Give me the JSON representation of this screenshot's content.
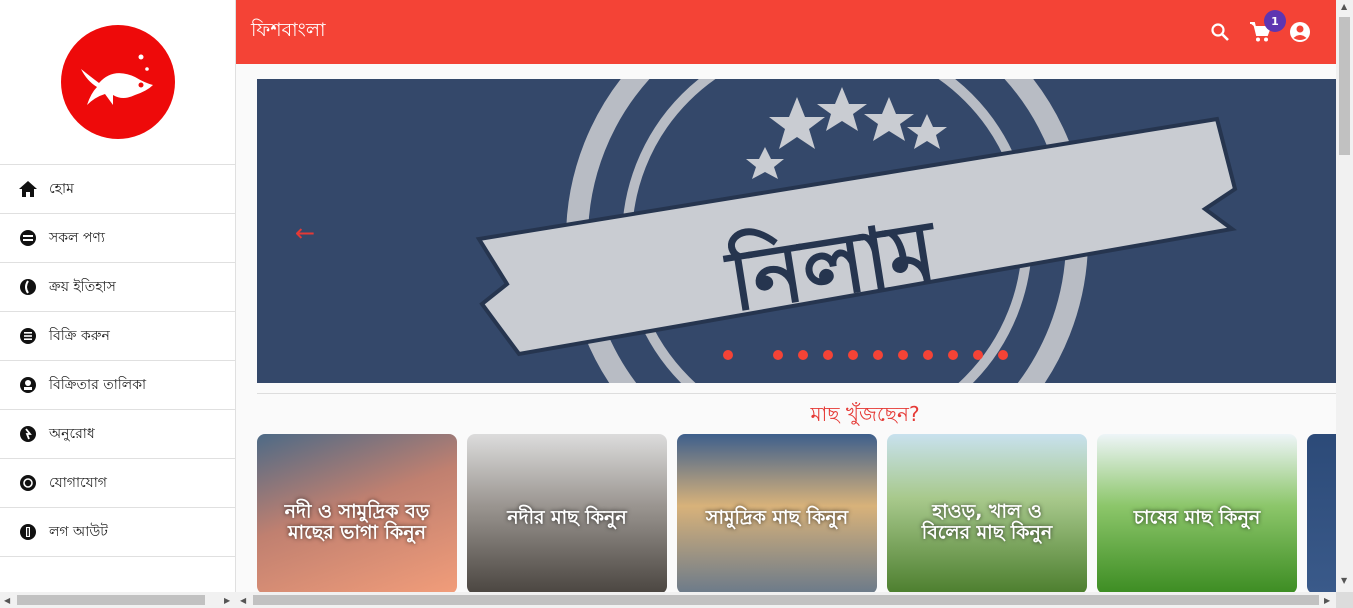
{
  "brand": {
    "title": "ফিশবাংলা",
    "primary_color": "#f44336",
    "logo_color": "#ee0a0a"
  },
  "sidebar": {
    "items": [
      {
        "label": "হোম",
        "icon": "home-icon"
      },
      {
        "label": "সকল পণ্য",
        "icon": "products-icon"
      },
      {
        "label": "ক্রয় ইতিহাস",
        "icon": "history-icon"
      },
      {
        "label": "বিক্রি করুন",
        "icon": "list-icon"
      },
      {
        "label": "বিক্রিতার তালিকা",
        "icon": "seller-icon"
      },
      {
        "label": "অনুরোধ",
        "icon": "request-icon"
      },
      {
        "label": "যোগাযোগ",
        "icon": "contact-icon"
      },
      {
        "label": "লগ আউট",
        "icon": "logout-icon"
      }
    ]
  },
  "header": {
    "cart_count": "1",
    "icons": [
      "search-icon",
      "cart-icon",
      "account-icon"
    ]
  },
  "banner": {
    "title": "নিলাম",
    "active_slide": 1,
    "slide_count": 12
  },
  "section": {
    "title": "মাছ খুঁজছেন?"
  },
  "cards": [
    {
      "label": "নদী ও সামুদ্রিক বড় মাছের ভাগা কিনুন",
      "colors": [
        "#c08070",
        "#f29d7a"
      ]
    },
    {
      "label": "নদীর মাছ কিনুন",
      "colors": [
        "#cfcfcf",
        "#5a5550"
      ]
    },
    {
      "label": "সামুদ্রিক মাছ কিনুন",
      "colors": [
        "#5a7ea8",
        "#b79666"
      ]
    },
    {
      "label": "হাওড়, খাল ও বিলের মাছ কিনুন",
      "colors": [
        "#bcd8e6",
        "#5f8e3c"
      ]
    },
    {
      "label": "চাষের মাছ কিনুন",
      "colors": [
        "#e8f1f4",
        "#4aa02c"
      ]
    }
  ]
}
